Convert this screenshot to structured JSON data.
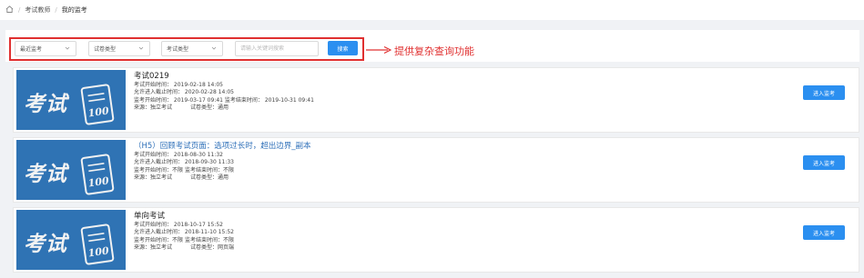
{
  "breadcrumb": {
    "items": [
      "考试教师",
      "我的监考"
    ],
    "separator": "/"
  },
  "filters": {
    "time_select": "最近监考",
    "paper_type_select": "试卷类型",
    "exam_type_select": "考试类型",
    "search_placeholder": "请输入关键词搜索",
    "search_button": "搜索"
  },
  "annotation": "提供复杂查询功能",
  "thumbnail": {
    "word": "考试",
    "score": "100"
  },
  "colors": {
    "primary": "#2b8ff0",
    "annotation_red": "#e03030",
    "thumb_blue": "#2f73b4",
    "link": "#2d6fb8"
  },
  "exams": [
    {
      "title": "考试0219",
      "line1": "考试开始时间： 2019-02-18 14:05",
      "line2": "允许进入截止时间： 2020-02-28 14:05",
      "line3a": "监考开始时间： 2019-03-17 09:41",
      "line3b": "监考结束时间： 2019-10-31 09:41",
      "line4a": "来源：独立考试",
      "line4b": "试卷类型：通用",
      "button": "进入监考"
    },
    {
      "title": "（H5）回顾考试页面：选项过长时，超出边界_副本",
      "line1": "考试开始时间： 2018-08-30 11:32",
      "line2": "允许进入截止时间： 2018-09-30 11:33",
      "line3a": "监考开始时间：不限",
      "line3b": "监考结束时间：不限",
      "line4a": "来源：独立考试",
      "line4b": "试卷类型：通用",
      "button": "进入监考"
    },
    {
      "title": "单向考试",
      "line1": "考试开始时间： 2018-10-17 15:52",
      "line2": "允许进入截止时间： 2018-11-10 15:52",
      "line3a": "监考开始时间：不限",
      "line3b": "监考结束时间：不限",
      "line4a": "来源：独立考试",
      "line4b": "试卷类型：网页端",
      "button": "进入监考"
    }
  ]
}
